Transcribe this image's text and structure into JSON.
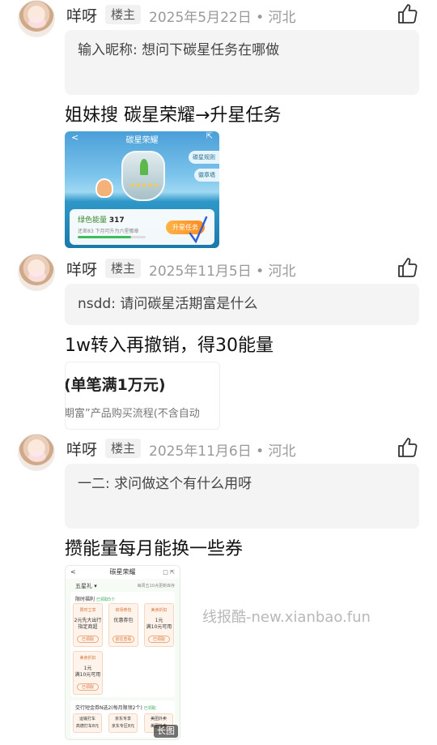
{
  "posts": [
    {
      "username": "咩呀",
      "badge": "楼主",
      "meta": "2025年5月22日 • 河北",
      "quote_name": "输入昵称:",
      "quote_text": "想问下碳星任务在哪做",
      "body": "姐妹搜 碳星荣耀→升星任务"
    },
    {
      "username": "咩呀",
      "badge": "楼主",
      "meta": "2025年11月5日 • 河北",
      "quote_name": "nsdd:",
      "quote_text": "请问碳星活期富是什么",
      "body": "1w转入再撤销，得30能量"
    },
    {
      "username": "咩呀",
      "badge": "楼主",
      "meta": "2025年11月6日 • 河北",
      "quote_name": "一二:",
      "quote_text": "求问做这个有什么用呀",
      "body": "攒能量每月能换一些券"
    }
  ],
  "image1": {
    "back": "<",
    "title": "碳星荣耀",
    "share": "⇱",
    "chip_rules": "碳星规则",
    "chip_store": "徽章墙",
    "stars": "★★★★★",
    "energy_label": "绿色能量",
    "energy_value": "317",
    "sub": "还差83 下月可升为六星徽章",
    "progress": 0.79,
    "upgrade_btn": "升星任务"
  },
  "image2": {
    "line1": "(单笔满1万元)",
    "line2": "期富”产品购买流程(不含自动"
  },
  "image3": {
    "back": "<",
    "title": "碳星荣耀",
    "icons": "□ ⇱",
    "selector": "五星礼 ▾",
    "note": "每周五10点更新库存",
    "section1": "限时福利",
    "section1_tag": "已领取5个",
    "cards": [
      {
        "name": "限时立享",
        "value": "2元先大出行\n指定商超",
        "btn": "已领取"
      },
      {
        "name": "商场券包",
        "value": "优惠券包",
        "btn": "前往查看"
      },
      {
        "name": "美食折扣",
        "value": "1元\n满10元可用",
        "btn": "已领取"
      }
    ],
    "card4": {
      "name": "美食折扣",
      "value": "1元\n满10元可用",
      "btn": "已领取"
    },
    "section2": "交行短金券N选2(每月限领2个)",
    "section2_tag": "已领取",
    "small_cards": [
      {
        "name": "运输打车",
        "value": "高德打车8元"
      },
      {
        "name": "京东专享",
        "value": "京东专区8元"
      },
      {
        "name": "美团外卖",
        "value": "美团外卖"
      }
    ],
    "long_pic_label": "长图"
  },
  "watermark": "线报酷-new.xianbao.fun"
}
